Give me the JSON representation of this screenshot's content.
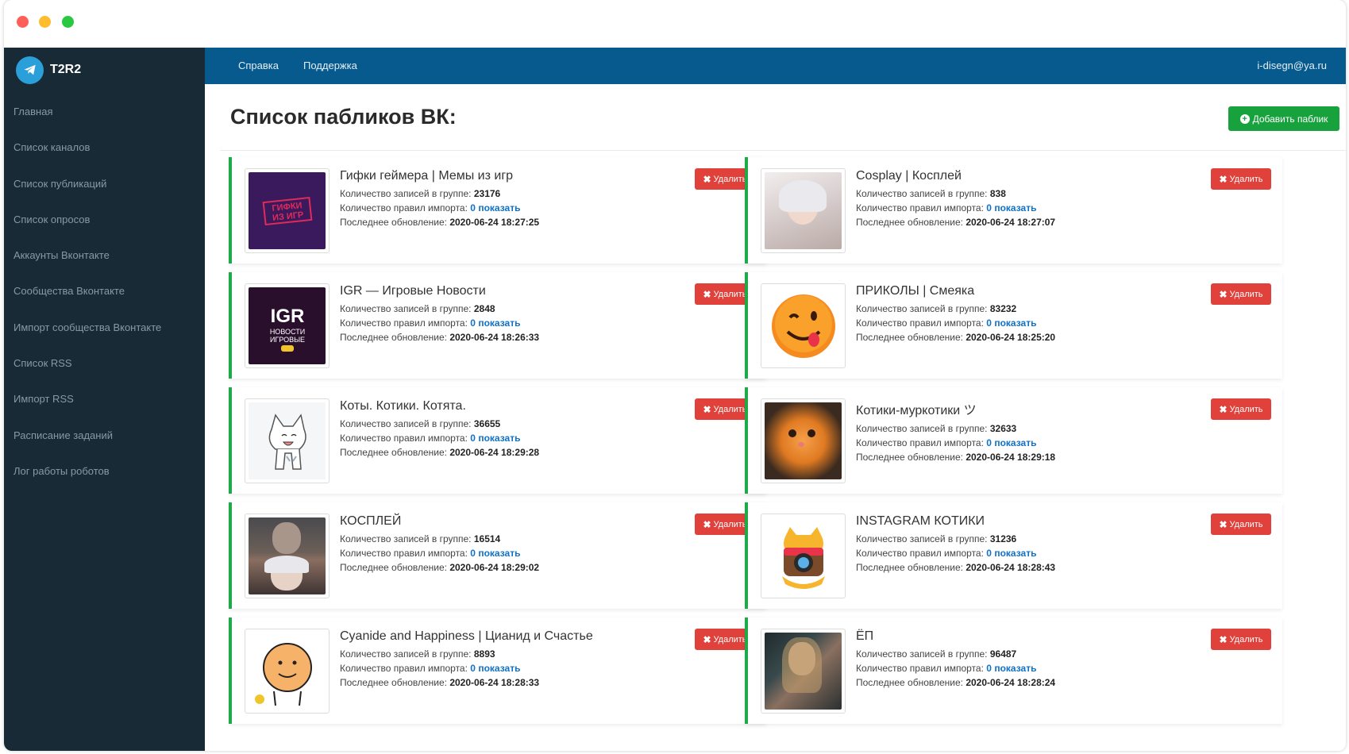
{
  "brand": {
    "name": "T2R2",
    "logo_icon": "telegram-icon",
    "color": "#2a9fd9"
  },
  "sidebar": {
    "items": [
      {
        "label": "Главная"
      },
      {
        "label": "Список каналов"
      },
      {
        "label": "Список публикаций"
      },
      {
        "label": "Список опросов"
      },
      {
        "label": "Аккаунты Вконтакте"
      },
      {
        "label": "Сообщества Вконтакте"
      },
      {
        "label": "Импорт сообщества Вконтакте"
      },
      {
        "label": "Список RSS"
      },
      {
        "label": "Импорт RSS"
      },
      {
        "label": "Расписание заданий"
      },
      {
        "label": "Лог работы роботов"
      }
    ]
  },
  "topbar": {
    "help": "Справка",
    "support": "Поддержка",
    "email": "i-disegn@ya.ru"
  },
  "page": {
    "title": "Список пабликов ВК:",
    "add_button": "Добавить паблик",
    "add_icon": "plus-circle-icon"
  },
  "labels": {
    "posts": "Количество записей в группе:",
    "rules": "Количество правил импорта:",
    "updated": "Последнее обновление:",
    "show": "показать",
    "delete": "Удалить",
    "delete_icon": "close-icon"
  },
  "colors": {
    "accent_green": "#1faa4a",
    "nav_bg": "#075a8e",
    "sidebar_bg": "#172a36",
    "delete_red": "#e0413b",
    "link_blue": "#1171c6"
  },
  "groups": [
    {
      "name": "Гифки геймера | Мемы из игр",
      "posts": "23176",
      "rules": "0",
      "updated": "2020-06-24 18:27:25",
      "thumb": "gifki-logo"
    },
    {
      "name": "Cosplay | Косплей",
      "posts": "838",
      "rules": "0",
      "updated": "2020-06-24 18:27:07",
      "thumb": "cosplay-photo"
    },
    {
      "name": "IGR — Игровые Новости",
      "posts": "2848",
      "rules": "0",
      "updated": "2020-06-24 18:26:33",
      "thumb": "igr-logo"
    },
    {
      "name": "ПРИКОЛЫ | Смеяка",
      "posts": "83232",
      "rules": "0",
      "updated": "2020-06-24 18:25:20",
      "thumb": "smiley-face"
    },
    {
      "name": "Коты. Котики. Котята.",
      "posts": "36655",
      "rules": "0",
      "updated": "2020-06-24 18:29:28",
      "thumb": "cat-drawing"
    },
    {
      "name": "Котики-муркотики ツ",
      "posts": "32633",
      "rules": "0",
      "updated": "2020-06-24 18:29:18",
      "thumb": "kitten-photo"
    },
    {
      "name": "КОСПЛЕЙ",
      "posts": "16514",
      "rules": "0",
      "updated": "2020-06-24 18:29:02",
      "thumb": "witcher-cosplay"
    },
    {
      "name": "INSTAGRAM КОТИКИ",
      "posts": "31236",
      "rules": "0",
      "updated": "2020-06-24 18:28:43",
      "thumb": "instagram-cat"
    },
    {
      "name": "Cyanide and Happiness | Цианид и Счастье",
      "posts": "8893",
      "rules": "0",
      "updated": "2020-06-24 18:28:33",
      "thumb": "cyanide-character"
    },
    {
      "name": "ЁП",
      "posts": "96487",
      "rules": "0",
      "updated": "2020-06-24 18:28:24",
      "thumb": "portrait-photo"
    }
  ]
}
